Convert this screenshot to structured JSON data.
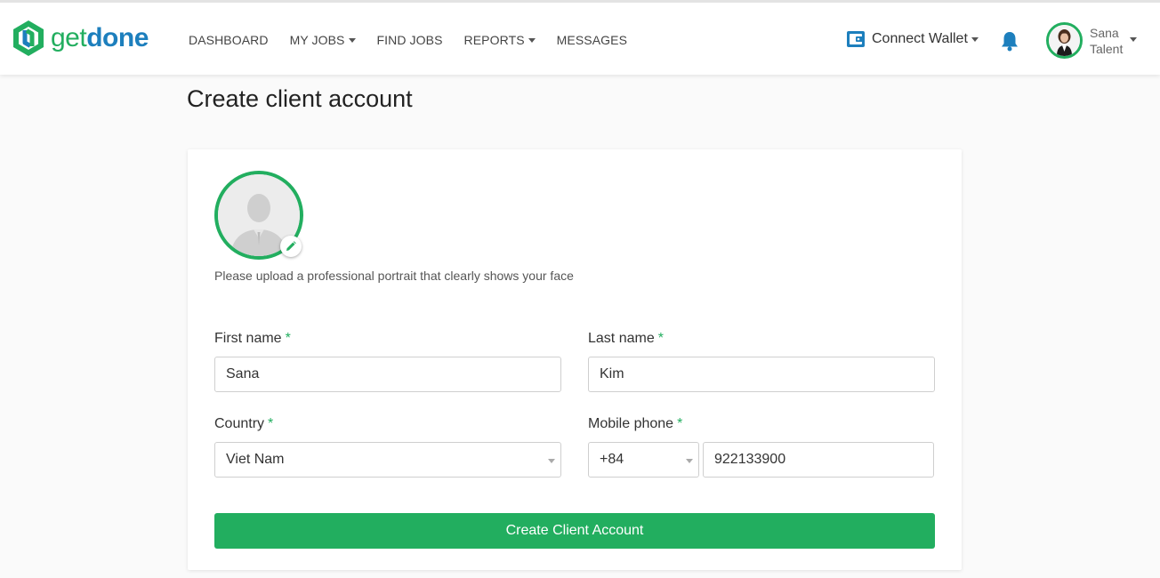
{
  "brand": {
    "word_get": "get",
    "word_done": "done",
    "green": "#22ae5f",
    "blue": "#1d7fbd"
  },
  "nav": [
    {
      "label": "DASHBOARD",
      "dropdown": false
    },
    {
      "label": "MY JOBS",
      "dropdown": true
    },
    {
      "label": "FIND JOBS",
      "dropdown": false
    },
    {
      "label": "REPORTS",
      "dropdown": true
    },
    {
      "label": "MESSAGES",
      "dropdown": false
    }
  ],
  "header": {
    "wallet_label": "Connect Wallet",
    "user_name": "Sana",
    "user_role": "Talent"
  },
  "page": {
    "title": "Create client account",
    "upload_hint": "Please upload a professional portrait that clearly shows your face",
    "required_mark": "*"
  },
  "form": {
    "first_name": {
      "label": "First name",
      "value": "Sana"
    },
    "last_name": {
      "label": "Last name",
      "value": "Kim"
    },
    "country": {
      "label": "Country",
      "value": "Viet Nam"
    },
    "mobile": {
      "label": "Mobile phone",
      "code": "+84",
      "number": "922133900"
    },
    "submit_label": "Create Client Account"
  },
  "icons": {
    "wallet": "wallet-icon",
    "bell": "bell-icon",
    "edit": "pencil-icon",
    "portrait": "user-placeholder-icon"
  }
}
